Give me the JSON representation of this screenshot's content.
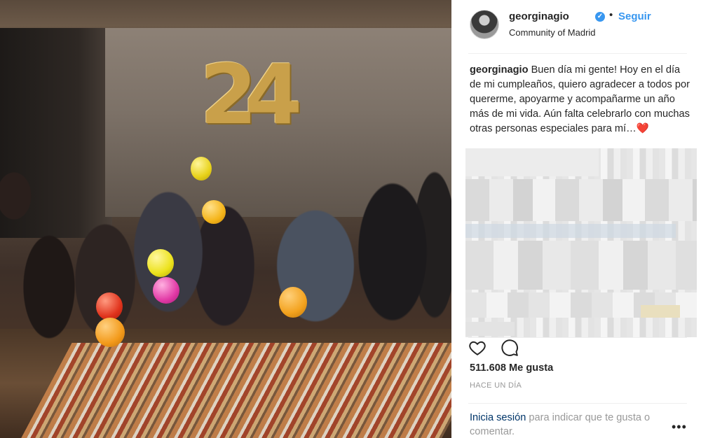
{
  "post": {
    "username": "georginagio",
    "separator": "•",
    "follow_label": "Seguir",
    "location": "Community of Madrid",
    "photo_number_decoration": "24"
  },
  "caption": {
    "username": "georginagio",
    "text": "Buen día mi gente! Hoy en el día de mi cumpleaños, quiero agradecer a todos por quererme, apoyarme y acompañarme un año más de mi vida. Aún falta celebrarlo con muchas otras personas especiales para mí…",
    "emoji": "❤️"
  },
  "actions": {
    "like_icon": "heart-outline-icon",
    "comment_icon": "comment-bubble-icon"
  },
  "stats": {
    "likes_text": "511.608 Me gusta",
    "time_text": "HACE UN DÍA"
  },
  "login_prompt": {
    "link_text": "Inicia sesión",
    "rest_text": " para indicar que te gusta o comentar."
  },
  "more_options": "•••",
  "colors": {
    "link_blue": "#3897f0",
    "dark_link": "#003569",
    "text": "#262626",
    "muted": "#999999"
  }
}
